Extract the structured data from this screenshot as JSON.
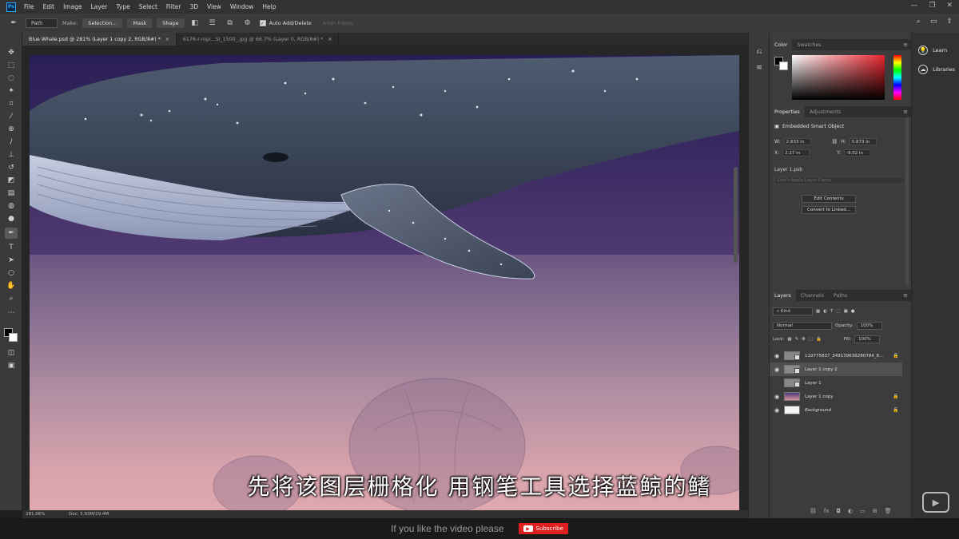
{
  "menubar": {
    "logo": "Ps",
    "items": [
      "File",
      "Edit",
      "Image",
      "Layer",
      "Type",
      "Select",
      "Filter",
      "3D",
      "View",
      "Window",
      "Help"
    ],
    "window_controls": [
      "—",
      "❐",
      "✕"
    ]
  },
  "options": {
    "tool_mode": "Path",
    "make_label": "Make:",
    "selection_btn": "Selection...",
    "mask_btn": "Mask",
    "shape_btn": "Shape",
    "auto_add_delete": "Auto Add/Delete",
    "align_edges": "Align Edges"
  },
  "tabs": [
    {
      "label": "Blue Whale.psd @ 281% (Layer 1 copy 2, RGB/8#) *",
      "close": "✕"
    },
    {
      "label": "6176-r-ropi...Sl_1500_.jpg @ 66.7% (Layer 0, RGB/8#) *",
      "close": "✕"
    }
  ],
  "status": {
    "zoom": "281.06%",
    "doc": "Doc: 5.93M/29.4M"
  },
  "subtitle": "先将该图层栅格化  用钢笔工具选择蓝鲸的鳍",
  "banner": {
    "text": "If you like the video please",
    "subscribe": "Subscribe"
  },
  "learn_panel": {
    "learn": "Learn",
    "libraries": "Libraries"
  },
  "color_panel": {
    "tabs": [
      "Color",
      "Swatches"
    ],
    "hue_color": "#e8242d"
  },
  "properties": {
    "tabs": [
      "Properties",
      "Adjustments"
    ],
    "title": "Embedded Smart Object",
    "w_label": "W:",
    "w": "2.833 in",
    "h_label": "H:",
    "h": "0.873 in",
    "x_label": "X:",
    "x": "2.27 in",
    "y_label": "Y:",
    "y": "-9.02 in",
    "source": "Layer 1.psb",
    "layer_comp": "Don't Apply Layer Comp",
    "edit_contents": "Edit Contents",
    "convert_linked": "Convert to Linked..."
  },
  "layers": {
    "tabs": [
      "Layers",
      "Channels",
      "Paths"
    ],
    "kind": "Kind",
    "blend_mode": "Normal",
    "opacity_label": "Opacity:",
    "opacity": "100%",
    "lock_label": "Lock:",
    "fill_label": "Fill:",
    "fill": "100%",
    "rows": [
      {
        "name": "119775837_349139636280784_8..."
      },
      {
        "name": "Layer 1 copy 2"
      },
      {
        "name": "Layer 1"
      },
      {
        "name": "Layer 1 copy"
      },
      {
        "name": "Background"
      }
    ]
  }
}
